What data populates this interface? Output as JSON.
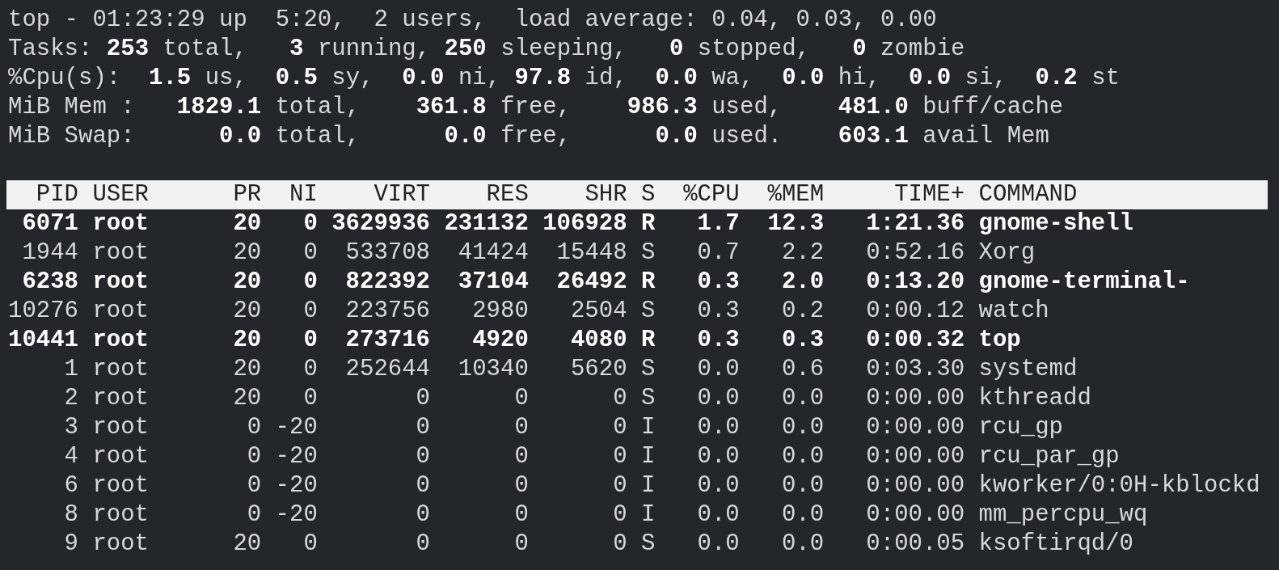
{
  "summary_lines": [
    "top - 01:23:29 up  5:20,  2 users,  load average: 0.04, 0.03, 0.00",
    "Tasks: **253** total,   **3** running, **250** sleeping,   **0** stopped,   **0** zombie",
    "%Cpu(s):  **1.5** us,  **0.5** sy,  **0.0** ni, **97.8** id,  **0.0** wa,  **0.0** hi,  **0.0** si,  **0.2** st",
    "MiB Mem :   **1829.1** total,    **361.8** free,    **986.3** used,    **481.0** buff/cache",
    "MiB Swap:      **0.0** total,      **0.0** free,      **0.0** used.    **603.1** avail Mem"
  ],
  "table": {
    "columns": [
      "PID",
      "USER",
      "PR",
      "NI",
      "VIRT",
      "RES",
      "SHR",
      "S",
      "%CPU",
      "%MEM",
      "TIME+",
      "COMMAND"
    ],
    "rows": [
      {
        "highlighted": true,
        "cells": [
          "6071",
          "root",
          "20",
          "0",
          "3629936",
          "231132",
          "106928",
          "R",
          "1.7",
          "12.3",
          "1:21.36",
          "gnome-shell"
        ]
      },
      {
        "highlighted": false,
        "cells": [
          "1944",
          "root",
          "20",
          "0",
          "533708",
          "41424",
          "15448",
          "S",
          "0.7",
          "2.2",
          "0:52.16",
          "Xorg"
        ]
      },
      {
        "highlighted": true,
        "cells": [
          "6238",
          "root",
          "20",
          "0",
          "822392",
          "37104",
          "26492",
          "R",
          "0.3",
          "2.0",
          "0:13.20",
          "gnome-terminal-"
        ]
      },
      {
        "highlighted": false,
        "cells": [
          "10276",
          "root",
          "20",
          "0",
          "223756",
          "2980",
          "2504",
          "S",
          "0.3",
          "0.2",
          "0:00.12",
          "watch"
        ]
      },
      {
        "highlighted": true,
        "cells": [
          "10441",
          "root",
          "20",
          "0",
          "273716",
          "4920",
          "4080",
          "R",
          "0.3",
          "0.3",
          "0:00.32",
          "top"
        ]
      },
      {
        "highlighted": false,
        "cells": [
          "1",
          "root",
          "20",
          "0",
          "252644",
          "10340",
          "5620",
          "S",
          "0.0",
          "0.6",
          "0:03.30",
          "systemd"
        ]
      },
      {
        "highlighted": false,
        "cells": [
          "2",
          "root",
          "20",
          "0",
          "0",
          "0",
          "0",
          "S",
          "0.0",
          "0.0",
          "0:00.00",
          "kthreadd"
        ]
      },
      {
        "highlighted": false,
        "cells": [
          "3",
          "root",
          "0",
          "-20",
          "0",
          "0",
          "0",
          "I",
          "0.0",
          "0.0",
          "0:00.00",
          "rcu_gp"
        ]
      },
      {
        "highlighted": false,
        "cells": [
          "4",
          "root",
          "0",
          "-20",
          "0",
          "0",
          "0",
          "I",
          "0.0",
          "0.0",
          "0:00.00",
          "rcu_par_gp"
        ]
      },
      {
        "highlighted": false,
        "cells": [
          "6",
          "root",
          "0",
          "-20",
          "0",
          "0",
          "0",
          "I",
          "0.0",
          "0.0",
          "0:00.00",
          "kworker/0:0H-kblockd"
        ]
      },
      {
        "highlighted": false,
        "cells": [
          "8",
          "root",
          "0",
          "-20",
          "0",
          "0",
          "0",
          "I",
          "0.0",
          "0.0",
          "0:00.00",
          "mm_percpu_wq"
        ]
      },
      {
        "highlighted": false,
        "cells": [
          "9",
          "root",
          "20",
          "0",
          "0",
          "0",
          "0",
          "S",
          "0.0",
          "0.0",
          "0:00.05",
          "ksoftirqd/0"
        ]
      }
    ]
  }
}
